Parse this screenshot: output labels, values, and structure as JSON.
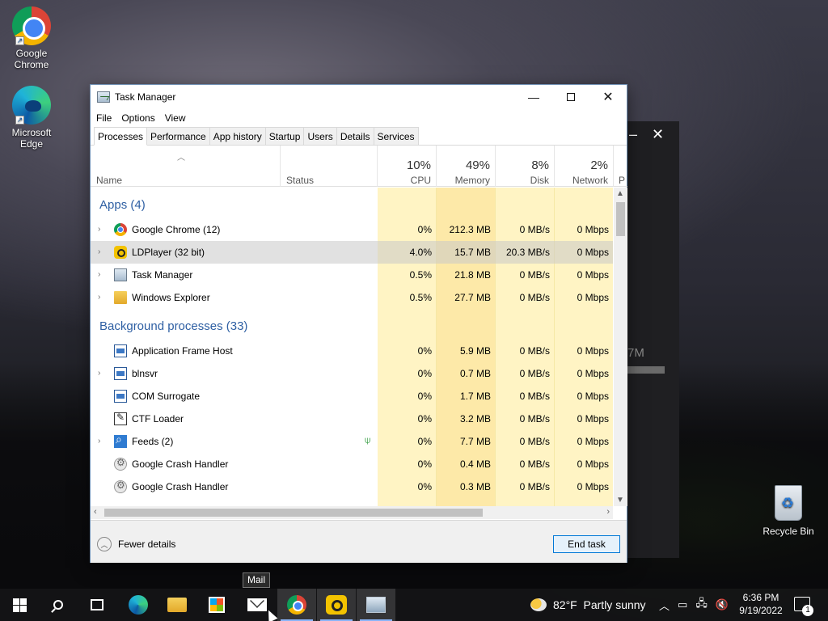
{
  "desktop": {
    "icons": [
      {
        "label": "Google Chrome"
      },
      {
        "label": "Microsoft Edge"
      }
    ],
    "recycle_bin": "Recycle Bin",
    "background_window": {
      "memory_fragment": "7M"
    }
  },
  "window": {
    "title": "Task Manager",
    "menu": [
      "File",
      "Options",
      "View"
    ],
    "tabs": [
      "Processes",
      "Performance",
      "App history",
      "Startup",
      "Users",
      "Details",
      "Services"
    ],
    "active_tab": "Processes"
  },
  "columns": {
    "name": "Name",
    "status": "Status",
    "cpu": {
      "pct": "10%",
      "label": "CPU"
    },
    "memory": {
      "pct": "49%",
      "label": "Memory"
    },
    "disk": {
      "pct": "8%",
      "label": "Disk"
    },
    "network": {
      "pct": "2%",
      "label": "Network"
    },
    "power_fragment": "P"
  },
  "groups": {
    "apps": "Apps (4)",
    "background": "Background processes (33)"
  },
  "processes": [
    {
      "name": "Google Chrome (12)",
      "cpu": "0%",
      "memory": "212.3 MB",
      "disk": "0 MB/s",
      "network": "0 Mbps"
    },
    {
      "name": "LDPlayer (32 bit)",
      "cpu": "4.0%",
      "memory": "15.7 MB",
      "disk": "20.3 MB/s",
      "network": "0 Mbps"
    },
    {
      "name": "Task Manager",
      "cpu": "0.5%",
      "memory": "21.8 MB",
      "disk": "0 MB/s",
      "network": "0 Mbps"
    },
    {
      "name": "Windows Explorer",
      "cpu": "0.5%",
      "memory": "27.7 MB",
      "disk": "0 MB/s",
      "network": "0 Mbps"
    },
    {
      "name": "Application Frame Host",
      "cpu": "0%",
      "memory": "5.9 MB",
      "disk": "0 MB/s",
      "network": "0 Mbps"
    },
    {
      "name": "blnsvr",
      "cpu": "0%",
      "memory": "0.7 MB",
      "disk": "0 MB/s",
      "network": "0 Mbps"
    },
    {
      "name": "COM Surrogate",
      "cpu": "0%",
      "memory": "1.7 MB",
      "disk": "0 MB/s",
      "network": "0 Mbps"
    },
    {
      "name": "CTF Loader",
      "cpu": "0%",
      "memory": "3.2 MB",
      "disk": "0 MB/s",
      "network": "0 Mbps"
    },
    {
      "name": "Feeds (2)",
      "cpu": "0%",
      "memory": "7.7 MB",
      "disk": "0 MB/s",
      "network": "0 Mbps"
    },
    {
      "name": "Google Crash Handler",
      "cpu": "0%",
      "memory": "0.4 MB",
      "disk": "0 MB/s",
      "network": "0 Mbps"
    },
    {
      "name": "Google Crash Handler",
      "cpu": "0%",
      "memory": "0.3 MB",
      "disk": "0 MB/s",
      "network": "0 Mbps"
    }
  ],
  "footer": {
    "fewer_details": "Fewer details",
    "end_task": "End task"
  },
  "taskbar": {
    "tooltip": "Mail",
    "weather_temp": "82°F",
    "weather_text": "Partly sunny",
    "time": "6:36 PM",
    "date": "9/19/2022",
    "notification_count": "1"
  }
}
